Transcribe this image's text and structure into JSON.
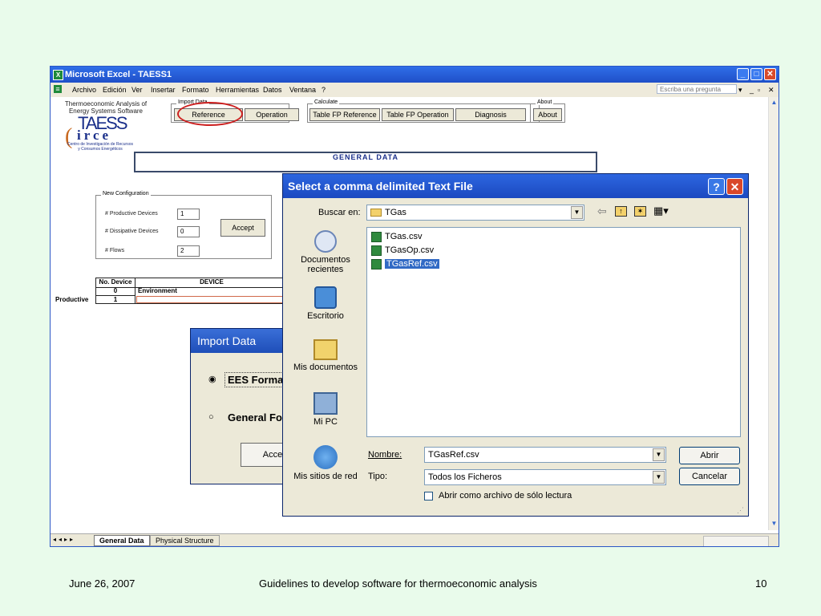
{
  "excel": {
    "title": "Microsoft Excel - TAESS1",
    "menu": [
      "Archivo",
      "Edición",
      "Ver",
      "Insertar",
      "Formato",
      "Herramientas",
      "Datos",
      "Ventana",
      "?"
    ],
    "ask_placeholder": "Escriba una pregunta",
    "sheet": {
      "app_line1": "Thermoeconomic Analysis of",
      "app_line2": "Energy Systems Software",
      "logo_taess": "TAESS",
      "logo_circe": "irce",
      "circe_line1": "Centro de Investigación de Recursos",
      "circe_line2": "y Consumos Energéticos",
      "import_group": "Import Data",
      "reference_btn": "Reference",
      "operation_btn": "Operation",
      "calculate_group": "Calculate",
      "table_fp_ref_btn": "Table FP Reference",
      "table_fp_op_btn": "Table FP Operation",
      "diagnosis_btn": "Diagnosis",
      "about_group": "About",
      "about_btn": "About",
      "general_data": "GENERAL DATA",
      "new_config": "New Configuration",
      "productive_devices_label": "# Productive Devices",
      "productive_devices_value": "1",
      "dissipative_devices_label": "# Dissipative Devices",
      "dissipative_devices_value": "0",
      "flows_label": "# Flows",
      "flows_value": "2",
      "accept_btn": "Accept",
      "col_no_device": "No. Device",
      "col_device": "DEVICE",
      "row0_no": "0",
      "row0_name": "Environment",
      "row1_label": "Productive",
      "row1_no": "1"
    },
    "tabs": [
      "General Data",
      "Physical Structure"
    ]
  },
  "import_dialog": {
    "title": "Import Data",
    "option1": "EES Forma",
    "option2": "General Fo",
    "accept": "Acce"
  },
  "file_dialog": {
    "title": "Select a comma delimited Text File",
    "look_in_label": "Buscar en:",
    "look_in_value": "TGas",
    "places": [
      "Documentos recientes",
      "Escritorio",
      "Mis documentos",
      "Mi PC",
      "Mis sitios de red"
    ],
    "files": [
      "TGas.csv",
      "TGasOp.csv",
      "TGasRef.csv"
    ],
    "selected_file": "TGasRef.csv",
    "name_label": "Nombre:",
    "name_value": "TGasRef.csv",
    "type_label": "Tipo:",
    "type_value": "Todos los Ficheros",
    "readonly_label": "Abrir como archivo de sólo lectura",
    "open_btn": "Abrir",
    "cancel_btn": "Cancelar"
  },
  "footer": {
    "date": "June 26, 2007",
    "caption": "Guidelines to develop software for thermoeconomic analysis",
    "page": "10"
  },
  "colors": {
    "titlebar": "#1f4fc8",
    "highlight": "#cc1f1f",
    "background": "#e9fbeb"
  }
}
